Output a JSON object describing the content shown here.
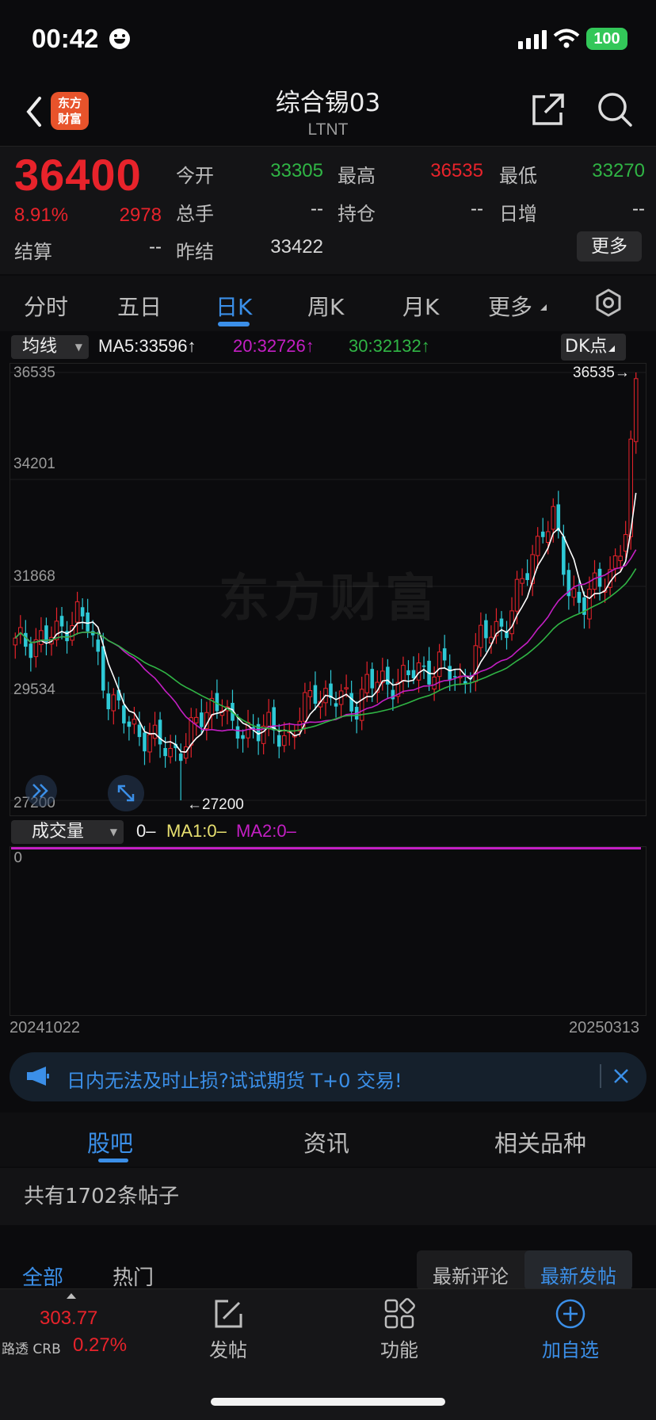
{
  "status_bar": {
    "time": "00:42",
    "battery": "100"
  },
  "header": {
    "title": "综合锡03",
    "code": "LTNT",
    "logo_text": "东方财富"
  },
  "quote": {
    "price": "36400",
    "change_pct": "8.91%",
    "change_abs": "2978",
    "fields": [
      {
        "label": "今开",
        "value": "33305",
        "color": "#30b545"
      },
      {
        "label": "最高",
        "value": "36535",
        "color": "#e8232b"
      },
      {
        "label": "最低",
        "value": "33270",
        "color": "#30b545"
      },
      {
        "label": "总手",
        "value": "--",
        "color": "#d8d8d8"
      },
      {
        "label": "持仓",
        "value": "--",
        "color": "#d8d8d8"
      },
      {
        "label": "日增",
        "value": "--",
        "color": "#d8d8d8"
      },
      {
        "label": "结算",
        "value": "--",
        "color": "#d8d8d8"
      },
      {
        "label": "昨结",
        "value": "33422",
        "color": "#d8d8d8"
      }
    ],
    "more_label": "更多"
  },
  "period_tabs": {
    "items": [
      "分时",
      "五日",
      "日K",
      "周K",
      "月K",
      "更多"
    ],
    "active": "日K"
  },
  "chart": {
    "ma_select": "均线",
    "ma5_label": "MA5:33596",
    "ma20_label": "20:32726",
    "ma30_label": "30:32132",
    "dk_label": "DK点",
    "price_ticks": [
      "36535",
      "34201",
      "31868",
      "29534",
      "27200"
    ],
    "max_label": "36535",
    "min_label": "27200",
    "watermark": "东方财富"
  },
  "chart_data": {
    "type": "candlestick",
    "x_range": [
      "20241022",
      "20250313"
    ],
    "ylim": [
      27200,
      36535
    ],
    "y_ticks": [
      36535,
      34201,
      31868,
      29534,
      27200
    ],
    "high": 36535,
    "low": 27200,
    "last_close": 36400,
    "series": [
      {
        "name": "MA5",
        "color": "#ffffff",
        "last": 33596
      },
      {
        "name": "MA20",
        "color": "#c41fc4",
        "last": 32726
      },
      {
        "name": "MA30",
        "color": "#30b545",
        "last": 32132
      }
    ],
    "volume": {
      "vol": 0,
      "MA1": 0,
      "MA2": 0
    }
  },
  "volume": {
    "select": "成交量",
    "vol_text": "0–",
    "ma1_text": "MA1:0–",
    "ma2_text": "MA2:0–",
    "zero": "0",
    "start_date": "20241022",
    "end_date": "20250313"
  },
  "banner": {
    "text": "日内无法及时止损?试试期货 T+0 交易!"
  },
  "section_tabs": {
    "items": [
      "股吧",
      "资讯",
      "相关品种"
    ],
    "active": "股吧"
  },
  "posts": {
    "count_text": "共有1702条帖子",
    "filter_all": "全部",
    "filter_hot": "热门",
    "sort_latest_comment": "最新评论",
    "sort_latest_post": "最新发帖"
  },
  "bottom_bar": {
    "ticker_value": "303.77",
    "ticker_name": "路透 CRB",
    "ticker_pct": "0.27%",
    "post_label": "发帖",
    "function_label": "功能",
    "add_label": "加自选"
  }
}
